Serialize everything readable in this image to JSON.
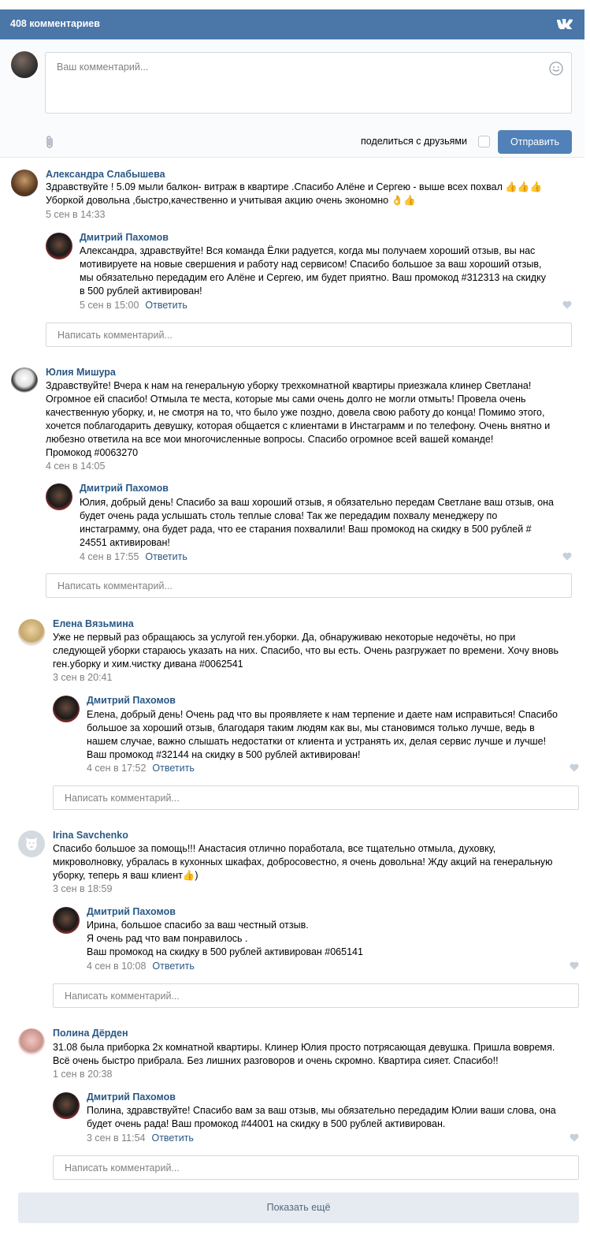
{
  "header": {
    "title": "408 комментариев",
    "logo": "vk-logo"
  },
  "composer": {
    "placeholder": "Ваш комментарий...",
    "share_label": "поделиться с друзьями",
    "send_label": "Отправить",
    "icons": [
      "smile-icon",
      "paperclip-icon"
    ]
  },
  "reply_placeholder": "Написать комментарий...",
  "more_label": "Показать ещё",
  "threads": [
    {
      "author": "Александра Слабышева",
      "text": "Здравствуйте ! 5.09 мыли балкон- витраж в квартире .Спасибо Алёне и Сергею - выше всех похвал 👍👍👍\nУборкой довольна ,быстро,качественно и учитывая акцию очень экономно 👌👍",
      "date": "5 сен в 14:33",
      "reply": {
        "author": "Дмитрий Пахомов",
        "text": "Александра, здравствуйте! Вся команда Ёлки радуется, когда мы получаем хороший отзыв, вы нас\nмотивируете на новые свершения и работу над сервисом! Спасибо большое за ваш хороший отзыв,\nмы обязательно передадим его Алёне и Сергею, им будет приятно. Ваш промокод #312313 на скидку\nв 500 рублей активирован!",
        "date": "5 сен в 15:00",
        "reply_label": "Ответить"
      }
    },
    {
      "author": "Юлия Мишура",
      "text": "Здравствуйте! Вчера к нам на генеральную уборку трехкомнатной квартиры приезжала клинер Светлана!\nОгромное ей спасибо! Отмыла те места, которые мы сами очень долго не могли отмыть! Провела очень\nкачественную уборку, и, не смотря на то, что было уже поздно, довела свою работу до конца! Помимо этого,\nхочется поблагодарить девушку, которая общается с клиентами в Инстаграмм и по телефону. Очень внятно и\nлюбезно ответила на все мои многочисленные вопросы. Спасибо огромное всей вашей команде!\nПромокод #0063270",
      "date": "4 сен в 14:05",
      "reply": {
        "author": "Дмитрий Пахомов",
        "text": "Юлия, добрый день! Спасибо за ваш хороший отзыв, я обязательно передам Светлане ваш отзыв, она\nбудет очень рада услышать столь теплые слова! Так же передадим похвалу менеджеру по\nинстаграмму, она будет рада, что ее старания похвалили! Ваш промокод на скидку в 500 рублей #\n24551 активирован!",
        "date": "4 сен в 17:55",
        "reply_label": "Ответить"
      }
    },
    {
      "author": "Елена Вязьмина",
      "text": "Уже не первый раз обращаюсь за услугой ген.уборки. Да, обнаруживаю некоторые недочёты, но при\nследующей уборки стараюсь указать на них. Спасибо, что вы есть. Очень разгружает по времени. Хочу вновь\nген.уборку и хим.чистку дивана #0062541",
      "date": "3 сен в 20:41",
      "reply": {
        "author": "Дмитрий Пахомов",
        "text": "Елена, добрый день! Очень рад что вы проявляете к нам терпение и даете нам исправиться! Спасибо\nбольшое за хороший отзыв, благодаря таким людям как вы, мы становимся только лучше, ведь в\nнашем случае, важно слышать недостатки от клиента и устранять их, делая сервис лучше и лучше!\nВаш промокод #32144 на скидку в 500 рублей активирован!",
        "date": "4 сен в 17:52",
        "reply_label": "Ответить"
      }
    },
    {
      "author": "Irina Savchenko",
      "text": "Спасибо большое за помощь!!! Анастасия отлично поработала, все тщательно отмыла, духовку,\nмикроволновку, убралась в кухонных шкафах, добросовестно, я очень довольна! Жду акций на генеральную\nуборку, теперь я ваш клиент👍)",
      "date": "3 сен в 18:59",
      "reply": {
        "author": "Дмитрий Пахомов",
        "text": "Ирина, большое спасибо за ваш честный отзыв.\nЯ очень рад что вам понравилось .\nВаш промокод на скидку в 500 рублей активирован #065141",
        "date": "4 сен в 10:08",
        "reply_label": "Ответить"
      }
    },
    {
      "author": "Полина Дёрден",
      "text": "31.08 была приборка 2х комнатной квартиры. Клинер Юлия просто потрясающая девушка. Пришла вовремя.\nВсё очень быстро прибрала. Без лишних разговоров и очень скромно. Квартира сияет. Спасибо!!",
      "date": "1 сен в 20:38",
      "reply": {
        "author": "Дмитрий Пахомов",
        "text": "Полина, здравствуйте! Спасибо вам за ваш отзыв, мы обязательно передадим Юлии ваши слова, она\nбудет очень рада! Ваш промокод #44001 на скидку в 500 рублей активирован.",
        "date": "3 сен в 11:54",
        "reply_label": "Ответить"
      }
    }
  ]
}
